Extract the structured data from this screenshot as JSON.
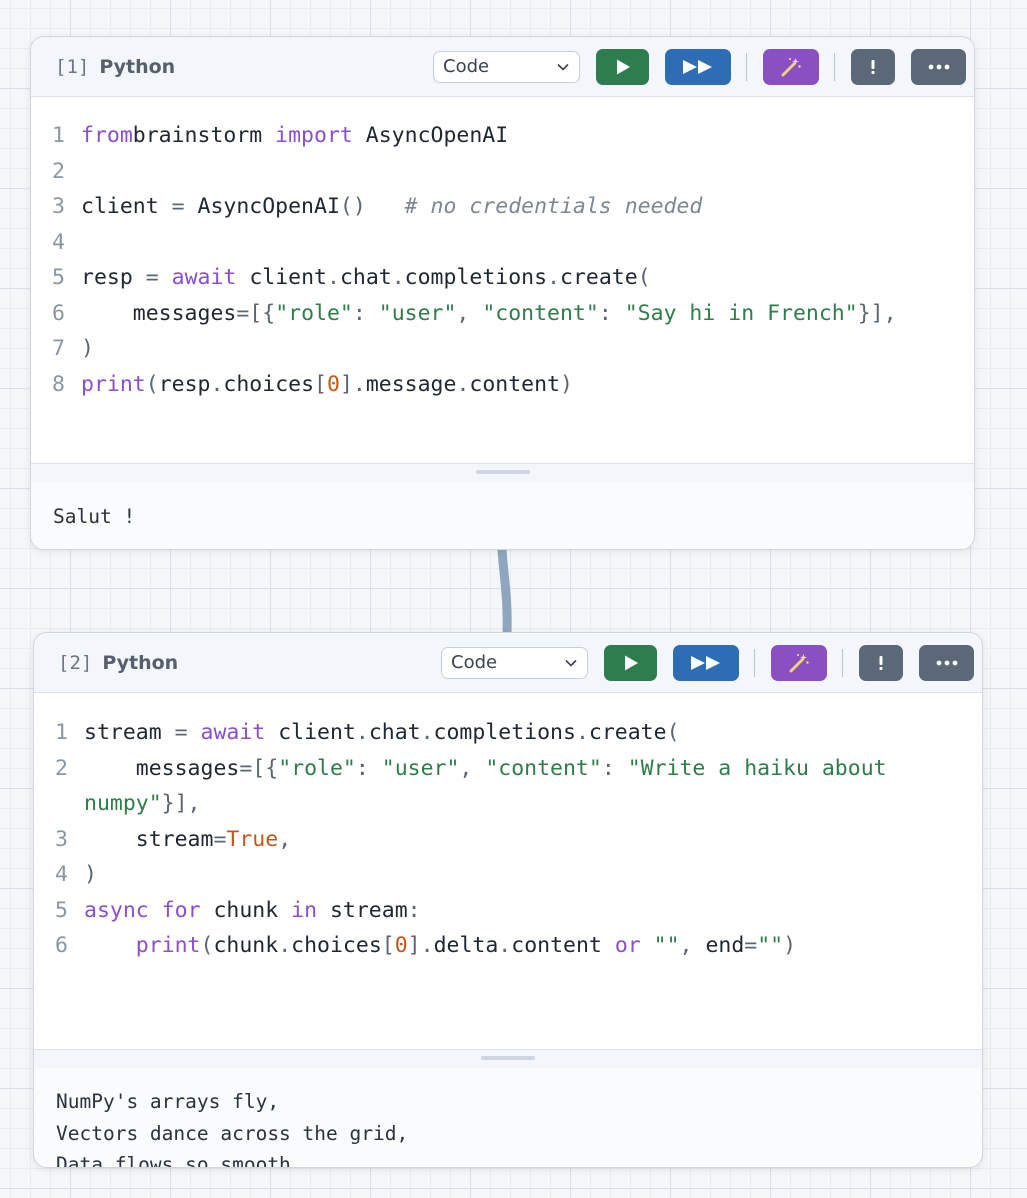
{
  "cells": [
    {
      "index": "[1]",
      "language": "Python",
      "cell_type": "Code",
      "lines": [
        {
          "n": "1",
          "tokens": [
            [
              "kw",
              "from"
            ],
            [
              "",
              "brainstorm "
            ],
            [
              "kw",
              "import"
            ],
            [
              "",
              " AsyncOpenAI"
            ]
          ]
        },
        {
          "n": "2",
          "tokens": []
        },
        {
          "n": "3",
          "tokens": [
            [
              "",
              "client "
            ],
            [
              "pun",
              "="
            ],
            [
              "",
              " AsyncOpenAI"
            ],
            [
              "pun",
              "()"
            ],
            [
              "",
              "   "
            ],
            [
              "com",
              "# no credentials needed"
            ]
          ]
        },
        {
          "n": "4",
          "tokens": []
        },
        {
          "n": "5",
          "tokens": [
            [
              "",
              "resp "
            ],
            [
              "pun",
              "="
            ],
            [
              "",
              " "
            ],
            [
              "kw",
              "await"
            ],
            [
              "",
              " client"
            ],
            [
              "pun",
              "."
            ],
            [
              "",
              "chat"
            ],
            [
              "pun",
              "."
            ],
            [
              "",
              "completions"
            ],
            [
              "pun",
              "."
            ],
            [
              "",
              "create"
            ],
            [
              "pun",
              "("
            ]
          ]
        },
        {
          "n": "6",
          "tokens": [
            [
              "",
              "    messages"
            ],
            [
              "pun",
              "=[{"
            ],
            [
              "str",
              "\"role\""
            ],
            [
              "pun",
              ": "
            ],
            [
              "str",
              "\"user\""
            ],
            [
              "pun",
              ", "
            ],
            [
              "str",
              "\"content\""
            ],
            [
              "pun",
              ": "
            ],
            [
              "str",
              "\"Say hi in French\""
            ],
            [
              "pun",
              "}],"
            ]
          ]
        },
        {
          "n": "7",
          "tokens": [
            [
              "pun",
              ")"
            ]
          ]
        },
        {
          "n": "8",
          "tokens": [
            [
              "kw",
              "print"
            ],
            [
              "pun",
              "("
            ],
            [
              "",
              "resp"
            ],
            [
              "pun",
              "."
            ],
            [
              "",
              "choices"
            ],
            [
              "pun",
              "["
            ],
            [
              "num",
              "0"
            ],
            [
              "pun",
              "]."
            ],
            [
              "",
              "message"
            ],
            [
              "pun",
              "."
            ],
            [
              "",
              "content"
            ],
            [
              "pun",
              ")"
            ]
          ]
        }
      ],
      "output": "Salut !"
    },
    {
      "index": "[2]",
      "language": "Python",
      "cell_type": "Code",
      "lines": [
        {
          "n": "1",
          "tokens": [
            [
              "",
              "stream "
            ],
            [
              "pun",
              "="
            ],
            [
              "",
              " "
            ],
            [
              "kw",
              "await"
            ],
            [
              "",
              " client"
            ],
            [
              "pun",
              "."
            ],
            [
              "",
              "chat"
            ],
            [
              "pun",
              "."
            ],
            [
              "",
              "completions"
            ],
            [
              "pun",
              "."
            ],
            [
              "",
              "create"
            ],
            [
              "pun",
              "("
            ]
          ]
        },
        {
          "n": "2",
          "tokens": [
            [
              "",
              "    messages"
            ],
            [
              "pun",
              "=[{"
            ],
            [
              "str",
              "\"role\""
            ],
            [
              "pun",
              ": "
            ],
            [
              "str",
              "\"user\""
            ],
            [
              "pun",
              ", "
            ],
            [
              "str",
              "\"content\""
            ],
            [
              "pun",
              ": "
            ],
            [
              "str",
              "\"Write a haiku about numpy\""
            ],
            [
              "pun",
              "}],"
            ]
          ]
        },
        {
          "n": "3",
          "tokens": [
            [
              "",
              "    stream"
            ],
            [
              "pun",
              "="
            ],
            [
              "num",
              "True"
            ],
            [
              "pun",
              ","
            ]
          ]
        },
        {
          "n": "4",
          "tokens": [
            [
              "pun",
              ")"
            ]
          ]
        },
        {
          "n": "5",
          "tokens": [
            [
              "kw",
              "async"
            ],
            [
              "",
              " "
            ],
            [
              "kw",
              "for"
            ],
            [
              "",
              " chunk "
            ],
            [
              "kw",
              "in"
            ],
            [
              "",
              " stream"
            ],
            [
              "pun",
              ":"
            ]
          ]
        },
        {
          "n": "6",
          "tokens": [
            [
              "",
              "    "
            ],
            [
              "kw",
              "print"
            ],
            [
              "pun",
              "("
            ],
            [
              "",
              "chunk"
            ],
            [
              "pun",
              "."
            ],
            [
              "",
              "choices"
            ],
            [
              "pun",
              "["
            ],
            [
              "num",
              "0"
            ],
            [
              "pun",
              "]."
            ],
            [
              "",
              "delta"
            ],
            [
              "pun",
              "."
            ],
            [
              "",
              "content "
            ],
            [
              "kw",
              "or"
            ],
            [
              "",
              " "
            ],
            [
              "str",
              "\"\""
            ],
            [
              "pun",
              ", "
            ],
            [
              "",
              "end"
            ],
            [
              "pun",
              "="
            ],
            [
              "str",
              "\"\""
            ],
            [
              "pun",
              ")"
            ]
          ]
        }
      ],
      "output": "NumPy's arrays fly,\nVectors dance across the grid,\nData flows so smooth."
    }
  ],
  "icons": {
    "run": "play-icon",
    "run_all": "fast-forward-icon",
    "ai": "magic-wand-icon",
    "info": "exclamation-icon",
    "more": "ellipsis-icon"
  },
  "colors": {
    "run": "#2e7d4f",
    "run_all": "#2e6db3",
    "ai": "#8a4fc0",
    "neutral": "#5a6877",
    "keyword": "#8a4fd0",
    "string": "#2f7d4a",
    "number": "#c2571a",
    "comment": "#7c8794"
  }
}
